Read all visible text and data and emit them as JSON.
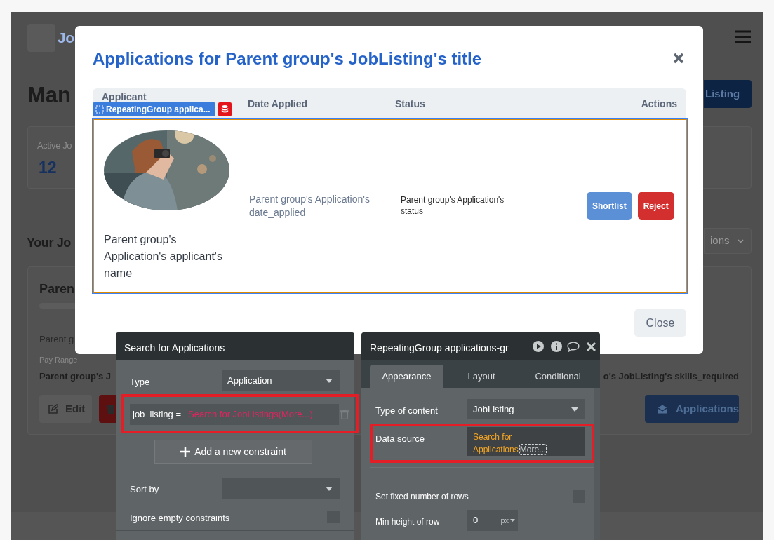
{
  "page": {
    "logo_text": "Jo",
    "heading": "Man",
    "new_button": "Listing",
    "stat_card": {
      "label": "Active Jo",
      "value": "12"
    },
    "section_heading": "Your Jo",
    "filter": "ions",
    "job_card": {
      "title": "Paren",
      "line": "Parent g",
      "pay_label": "Pay Range",
      "pay_value": "Parent group's J",
      "skills": "o's JobListing's skills_required",
      "buttons": [
        {
          "kind": "edit",
          "label": "Edit"
        },
        {
          "kind": "delete"
        },
        {
          "kind": "applications",
          "label": "Applications"
        }
      ]
    }
  },
  "modal": {
    "title": "Applications for Parent group's JobListing's title",
    "element_tag": "RepeatingGroup applica...",
    "columns": [
      {
        "label": "Applicant"
      },
      {
        "label": "Date Applied"
      },
      {
        "label": "Status"
      },
      {
        "label": "Actions"
      }
    ],
    "row": {
      "applicant_name": "Parent group's Application's applicant's name",
      "date_applied": "Parent group's Application's date_applied",
      "status": "Parent group's Application's status",
      "actions": [
        {
          "kind": "shortlist",
          "label": "Shortlist"
        },
        {
          "kind": "reject",
          "label": "Reject"
        }
      ]
    },
    "close_button": "Close"
  },
  "search_panel": {
    "title": "Search for Applications",
    "type_label": "Type",
    "type_value": "Application",
    "constraint": {
      "field": "job_listing =",
      "value": "Search for JobListings(More...)"
    },
    "add_button": "Add a new constraint",
    "sort_label": "Sort by",
    "ignore_label": "Ignore empty constraints",
    "ignore_checked": false
  },
  "property_panel": {
    "title": "RepeatingGroup applications-gr",
    "tabs": [
      {
        "label": "Appearance",
        "selected": true
      },
      {
        "label": "Layout",
        "selected": false
      },
      {
        "label": "Conditional",
        "selected": false
      }
    ],
    "content_label": "Type of content",
    "content_value": "JobListing",
    "source_label": "Data source",
    "source_value": "Search for Applications",
    "source_more": "More...",
    "fixed_rows_label": "Set fixed number of rows",
    "fixed_rows_checked": false,
    "min_height_label": "Min height of row",
    "min_height_value": "0",
    "min_height_unit": "px"
  }
}
